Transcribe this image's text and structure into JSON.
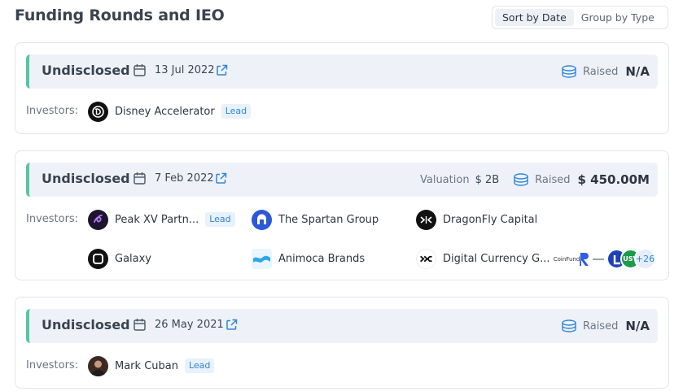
{
  "header": {
    "title": "Funding Rounds and IEO"
  },
  "sort_toggle": {
    "options": [
      "Sort by Date",
      "Group by Type"
    ],
    "active": "Sort by Date"
  },
  "rounds": [
    {
      "name": "Undisclosed",
      "date": "13 Jul 2022",
      "raised_label": "Raised",
      "raised_value": "N/A",
      "investors_label": "Investors:",
      "investors": [
        {
          "name": "Disney Accelerator",
          "lead": "Lead",
          "icon": "disney-logo-icon"
        }
      ]
    },
    {
      "name": "Undisclosed",
      "date": "7 Feb 2022",
      "valuation_label": "Valuation",
      "valuation_value": "$ 2B",
      "raised_label": "Raised",
      "raised_value": "$ 450.00M",
      "investors_label": "Investors:",
      "investors": [
        {
          "name": "Peak XV Partn...",
          "lead": "Lead",
          "icon": "peak-xv-logo-icon"
        },
        {
          "name": "The Spartan Group",
          "icon": "spartan-logo-icon"
        },
        {
          "name": "DragonFly Capital",
          "icon": "dragonfly-logo-icon"
        },
        {
          "name": "Galaxy",
          "icon": "galaxy-logo-icon"
        },
        {
          "name": "Animoca Brands",
          "icon": "animoca-logo-icon"
        },
        {
          "name": "Digital Currency G...",
          "icon": "dcg-logo-icon"
        }
      ],
      "more_logos": [
        {
          "text": "CoinFund",
          "icon": "coinfund-logo-icon"
        },
        {
          "text": "R",
          "icon": "republic-logo-icon"
        },
        {
          "text": "",
          "icon": "small-logo-icon"
        },
        {
          "text": "",
          "icon": "lightspeed-logo-icon"
        },
        {
          "text": "USV",
          "icon": "usv-logo-icon"
        }
      ],
      "more_count": "+26"
    },
    {
      "name": "Undisclosed",
      "date": "26 May 2021",
      "raised_label": "Raised",
      "raised_value": "N/A",
      "investors_label": "Investors:",
      "investors": [
        {
          "name": "Mark Cuban",
          "lead": "Lead",
          "icon": "mark-cuban-avatar-icon"
        }
      ]
    }
  ],
  "colors": {
    "accent_bar": "#55c6a0",
    "lead_text": "#2e86d6",
    "link_icon": "#2e86d6",
    "card_head_bg": "#eef2f8"
  }
}
